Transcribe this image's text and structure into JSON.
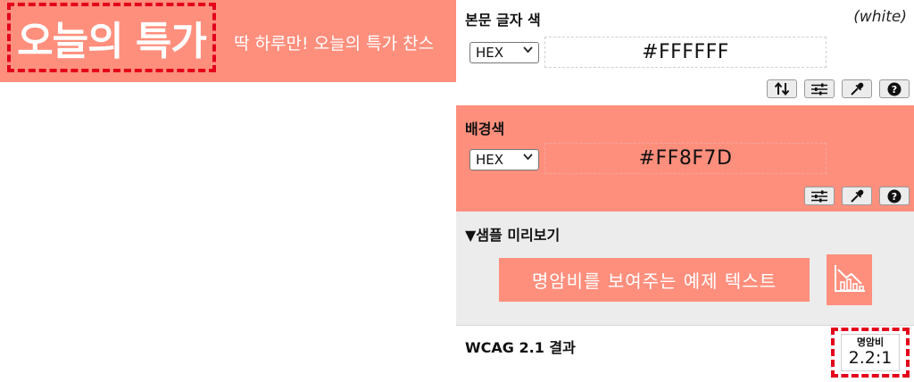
{
  "banner": {
    "title": "오늘의 특가",
    "subtitle": "딱 하루만! 오늘의 특가 찬스",
    "background_color": "#FF8F7D",
    "text_color": "#FFFFFF"
  },
  "text_color_section": {
    "label": "본문 글자 색",
    "color_name": "(white)",
    "format": "HEX",
    "value": "#FFFFFF",
    "tools": [
      {
        "icon": "swap-icon"
      },
      {
        "icon": "sliders-icon"
      },
      {
        "icon": "eyedropper-icon"
      },
      {
        "icon": "help-icon",
        "label": "?"
      }
    ]
  },
  "background_section": {
    "label": "배경색",
    "format": "HEX",
    "value": "#FF8F7D",
    "tools": [
      {
        "icon": "sliders-icon"
      },
      {
        "icon": "eyedropper-icon"
      },
      {
        "icon": "help-icon",
        "label": "?"
      }
    ]
  },
  "sample_section": {
    "heading": "▼샘플 미리보기",
    "sample_text": "명암비를 보여주는 예제 텍스트",
    "icon": "chart-icon"
  },
  "result_section": {
    "label": "WCAG 2.1 결과",
    "ratio_caption": "명암비",
    "ratio_value": "2.2:1"
  },
  "colors": {
    "accent": "#FF8F7D",
    "highlight_dash": "#E4001B",
    "panel_gray": "#ECECEC"
  }
}
